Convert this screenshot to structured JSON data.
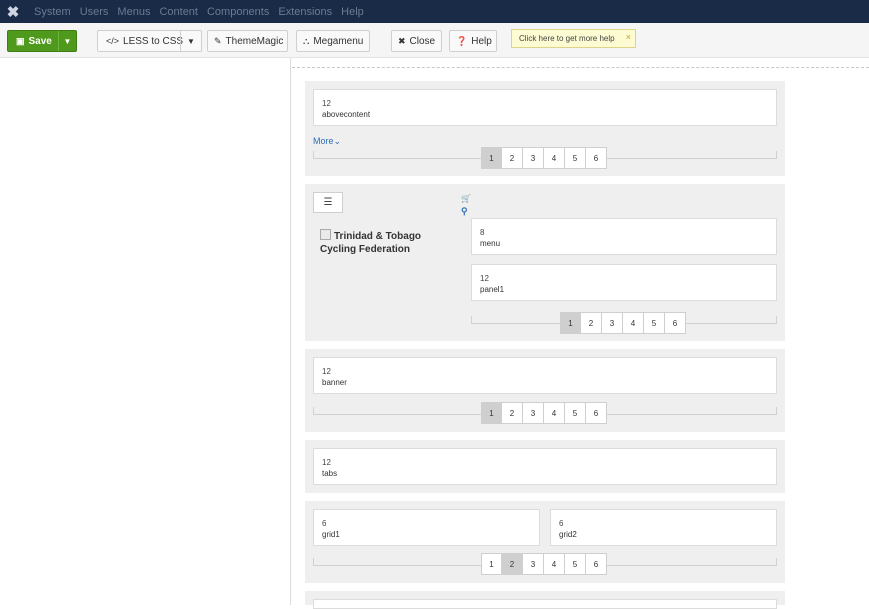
{
  "menubar": {
    "items": [
      "System",
      "Users",
      "Menus",
      "Content",
      "Components",
      "Extensions",
      "Help"
    ]
  },
  "toolbar": {
    "save_label": "Save",
    "less_label": "LESS to CSS",
    "thememagic_label": "ThemeMagic",
    "megamenu_label": "Megamenu",
    "close_label": "Close",
    "help_label": "Help",
    "tooltip": "Click here to get more help",
    "tooltip_close": "×"
  },
  "sections": {
    "s1": {
      "block": {
        "num": "12",
        "name": "abovecontent"
      },
      "more": "More",
      "pager": [
        "1",
        "2",
        "3",
        "4",
        "5",
        "6"
      ]
    },
    "s2": {
      "logo_text": "Trinidad & Tobago Cycling Federation",
      "block1": {
        "num": "8",
        "name": "menu"
      },
      "block2": {
        "num": "12",
        "name": "panel1"
      },
      "pager": [
        "1",
        "2",
        "3",
        "4",
        "5",
        "6"
      ]
    },
    "s3": {
      "block": {
        "num": "12",
        "name": "banner"
      },
      "pager": [
        "1",
        "2",
        "3",
        "4",
        "5",
        "6"
      ]
    },
    "s4": {
      "block": {
        "num": "12",
        "name": "tabs"
      }
    },
    "s5": {
      "block1": {
        "num": "6",
        "name": "grid1"
      },
      "block2": {
        "num": "6",
        "name": "grid2"
      },
      "pager": [
        "1",
        "2",
        "3",
        "4",
        "5",
        "6"
      ]
    }
  },
  "colors": {
    "menubar_bg": "#1a2b47",
    "save_green": "#4f9a1c",
    "link_blue": "#2f6db4",
    "tooltip_bg": "#fdfbd2"
  }
}
